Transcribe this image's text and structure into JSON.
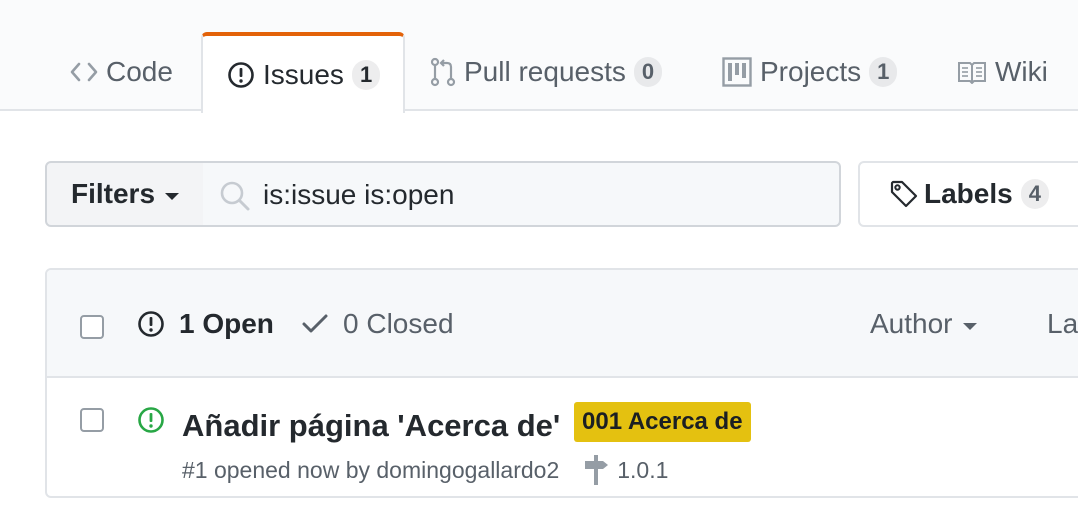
{
  "reponav": {
    "tabs": [
      {
        "label": "Code",
        "icon": "code-icon",
        "counter": ""
      },
      {
        "label": "Issues",
        "icon": "issue-opened-icon",
        "counter": "1"
      },
      {
        "label": "Pull requests",
        "icon": "git-pull-request-icon",
        "counter": "0"
      },
      {
        "label": "Projects",
        "icon": "project-icon",
        "counter": "1"
      },
      {
        "label": "Wiki",
        "icon": "book-icon",
        "counter": ""
      }
    ],
    "selected_accent": "#e36209"
  },
  "filters": {
    "label": "Filters",
    "search_value": "is:issue is:open"
  },
  "labels": {
    "label": "Labels",
    "count": "4"
  },
  "issues_header": {
    "open_label": "1 Open",
    "closed_label": "0 Closed",
    "author_label": "Author",
    "label_label": "La"
  },
  "issues": [
    {
      "title": "Añadir página 'Acerca de'",
      "label": "001 Acerca de",
      "label_color": "#e4c110",
      "meta": "#1 opened now by",
      "author": "domingogallardo2",
      "milestone": "1.0.1",
      "status_color": "#28a745"
    }
  ]
}
